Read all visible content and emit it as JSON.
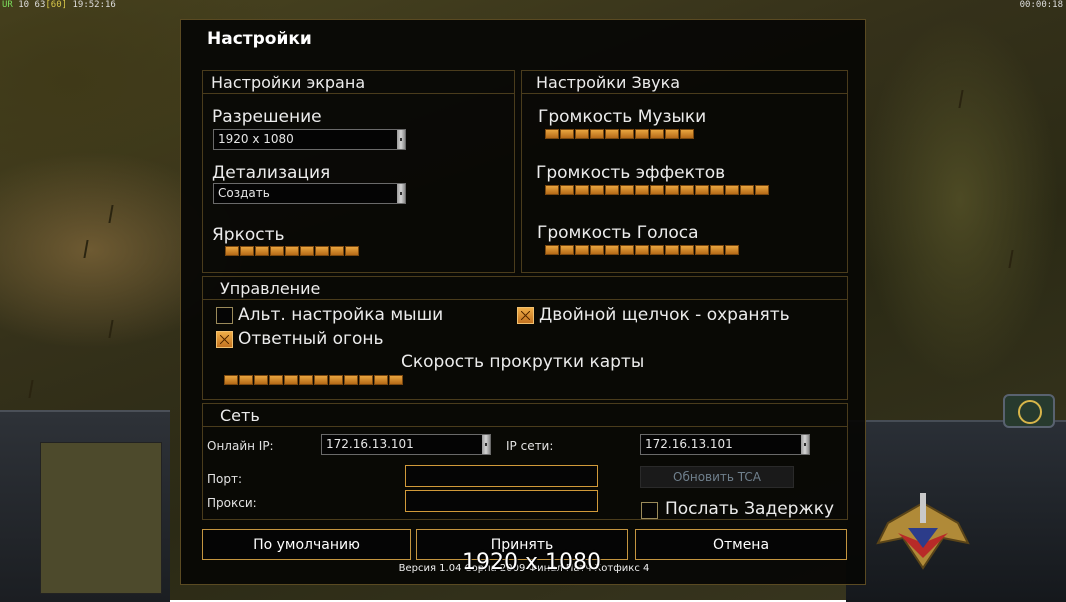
{
  "hud": {
    "stat_green": "UR",
    "stat_a": "10",
    "stat_b": "63",
    "stat_yellow": "[60]",
    "time": "19:52:16",
    "clock": "00:00:18"
  },
  "dialog": {
    "title": "Настройки",
    "version": "Версия 1.04 Сорпа 2009 Финал Патч Хотфикс 4",
    "resolution_overlay": "1920 x 1080"
  },
  "screen": {
    "title": "Настройки экрана",
    "resolution_label": "Разрешение",
    "resolution_value": "1920 x 1080",
    "detail_label": "Детализация",
    "detail_value": "Создать",
    "brightness_label": "Яркость",
    "brightness_level": 9,
    "brightness_max": 9
  },
  "sound": {
    "title": "Настройки Звука",
    "music_label": "Громкость Музыки",
    "music_level": 10,
    "music_max": 10,
    "effects_label": "Громкость эффектов",
    "effects_level": 15,
    "effects_max": 15,
    "voice_label": "Громкость Голоса",
    "voice_level": 13,
    "voice_max": 13
  },
  "controls": {
    "title": "Управление",
    "alt_mouse_label": "Альт. настройка мыши",
    "alt_mouse_checked": false,
    "double_click_label": "Двойной щелчок - охранять",
    "double_click_checked": true,
    "return_fire_label": "Ответный огонь",
    "return_fire_checked": true,
    "scroll_speed_label": "Скорость прокрутки карты",
    "scroll_speed_level": 12,
    "scroll_speed_max": 12
  },
  "network": {
    "title": "Сеть",
    "online_ip_label": "Онлайн IP:",
    "online_ip_value": "172.16.13.101",
    "lan_ip_label": "IP сети:",
    "lan_ip_value": "172.16.13.101",
    "port_label": "Порт:",
    "port_value": "",
    "proxy_label": "Прокси:",
    "proxy_value": "",
    "update_tca_label": "Обновить TCA",
    "send_delay_label": "Послать Задержку",
    "send_delay_checked": false
  },
  "buttons": {
    "default_label": "По умолчанию",
    "accept_label": "Принять",
    "cancel_label": "Отмена"
  },
  "colors": {
    "accent": "#e9a540",
    "frame": "#4a3c1c"
  }
}
